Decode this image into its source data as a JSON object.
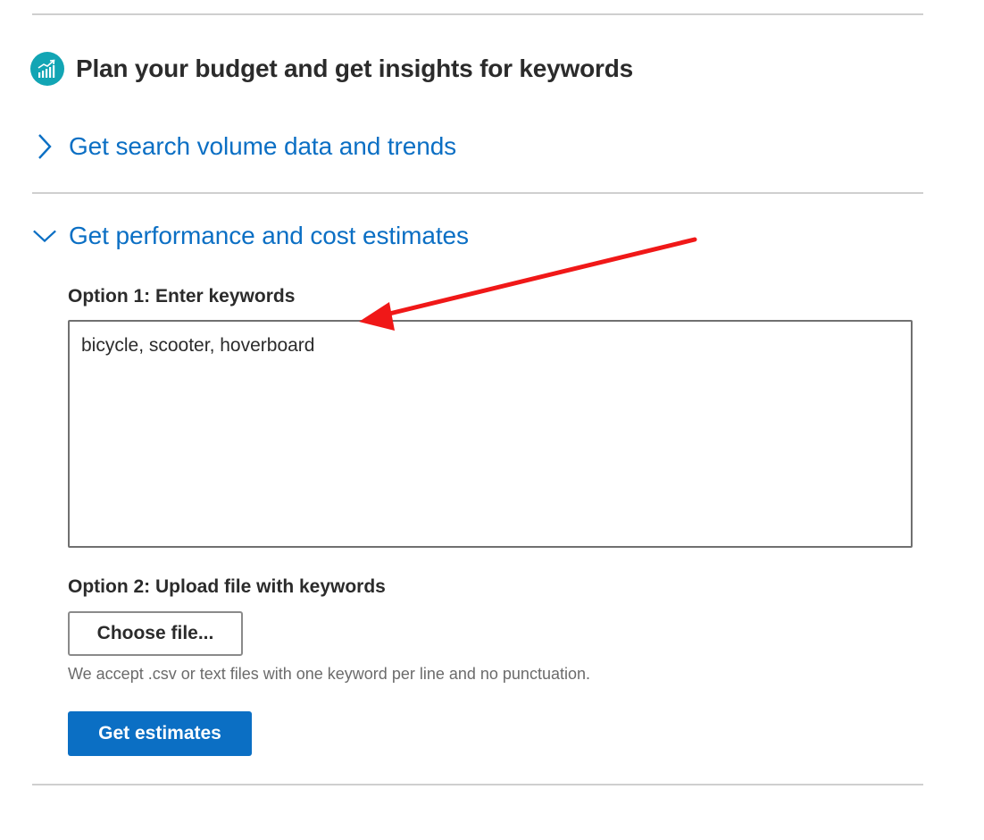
{
  "header": {
    "title": "Plan your budget and get insights for keywords",
    "icon": "chart-growth-icon",
    "icon_color": "#12a5b4"
  },
  "accordions": [
    {
      "label": "Get search volume data and trends",
      "expanded": false
    },
    {
      "label": "Get performance and cost estimates",
      "expanded": true
    }
  ],
  "option1": {
    "label": "Option 1: Enter keywords",
    "value": "bicycle, scooter, hoverboard"
  },
  "option2": {
    "label": "Option 2: Upload file with keywords",
    "button_label": "Choose file...",
    "help_text": "We accept .csv or text files with one keyword per line and no punctuation."
  },
  "actions": {
    "get_estimates_label": "Get estimates"
  },
  "colors": {
    "link_blue": "#0b6fc4",
    "primary_button": "#0b6fc4",
    "annotation_red": "#f01818"
  }
}
